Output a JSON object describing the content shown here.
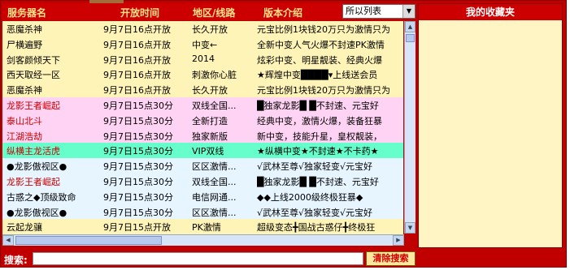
{
  "header": {
    "col_name": "服务器名",
    "col_time": "开放时间",
    "col_area": "地区/线路",
    "col_intro": "版本介绍",
    "filter_selected": "所以列表"
  },
  "rows": [
    {
      "name": "恶魔杀神",
      "time": "9月7日16点开放",
      "area": "长久开放",
      "intro": "元宝比例1块钱20万只为激情只为",
      "bg": "bg-y",
      "nc": ""
    },
    {
      "name": "尸横遍野",
      "time": "9月7日16点开放",
      "area": "中变←",
      "intro": "全新中变人气火爆不封速PK激情",
      "bg": "bg-y",
      "nc": ""
    },
    {
      "name": "剑客颜倾天下",
      "time": "9月7日16点开放",
      "area": "2014",
      "intro": "炫彩中变、明星靓装、经典火爆",
      "bg": "bg-y",
      "nc": ""
    },
    {
      "name": "西天取经一区",
      "time": "9月7日16点开放",
      "area": "刺激你心脏",
      "intro": "★辉煌中变████▾上线送会员",
      "bg": "bg-y",
      "nc": ""
    },
    {
      "name": "恶魔杀神",
      "time": "9月7日16点开放",
      "area": "长久开放",
      "intro": "元宝比例1块钱20万只为激情只为",
      "bg": "bg-y",
      "nc": ""
    },
    {
      "name": "龙影王者崛起",
      "time": "9月7日15点30分",
      "area": "双线全国...",
      "intro": "█独家龙影█ █不封速、元宝好",
      "bg": "bg-p",
      "nc": "name-red"
    },
    {
      "name": "泰山北斗",
      "time": "9月7日15点30分",
      "area": "全新打造",
      "intro": "经典中变，激情火爆，装备狂暴",
      "bg": "bg-p",
      "nc": "name-red"
    },
    {
      "name": "江湖浩劫",
      "time": "9月7日15点30分",
      "area": "独家新版",
      "intro": "新中变，技能升星，皇权靓装，",
      "bg": "bg-p",
      "nc": "name-red"
    },
    {
      "name": "纵横主龙活虎",
      "time": "9月7日15点30分",
      "area": "VIP双线",
      "intro": "★纵横中变★不封速★不卡药★",
      "bg": "bg-c",
      "nc": "name-red"
    },
    {
      "name": "●龙影傲视区●",
      "time": "9月7日15点30分",
      "area": "区区激情...",
      "intro": "√武林至尊√独家轻变√元宝好",
      "bg": "bg-b",
      "nc": ""
    },
    {
      "name": "龙影王者崛起",
      "time": "9月7日15点30分",
      "area": "双线全国...",
      "intro": "█独家龙影█ █不封速、元宝好",
      "bg": "bg-b",
      "nc": "name-red"
    },
    {
      "name": "古惑之◆顶级致命",
      "time": "9月7日15点30分",
      "area": "电信网通...",
      "intro": "◆◆上线2000级终极狂暴◆",
      "bg": "bg-b",
      "nc": ""
    },
    {
      "name": "●龙影傲视区●",
      "time": "9月7日15点30分",
      "area": "区区激情...",
      "intro": "√武林至尊√独家轻变√元宝好",
      "bg": "bg-b",
      "nc": ""
    },
    {
      "name": "云起龙骧",
      "time": "9月7日15点开放",
      "area": "PK激情",
      "intro": "超级变态╋国战古惑仔╋终极狂",
      "bg": "bg-y",
      "nc": ""
    }
  ],
  "favorites": {
    "title": "我的收藏夹"
  },
  "search": {
    "label": "搜索:",
    "value": "",
    "button": "清除搜索"
  }
}
